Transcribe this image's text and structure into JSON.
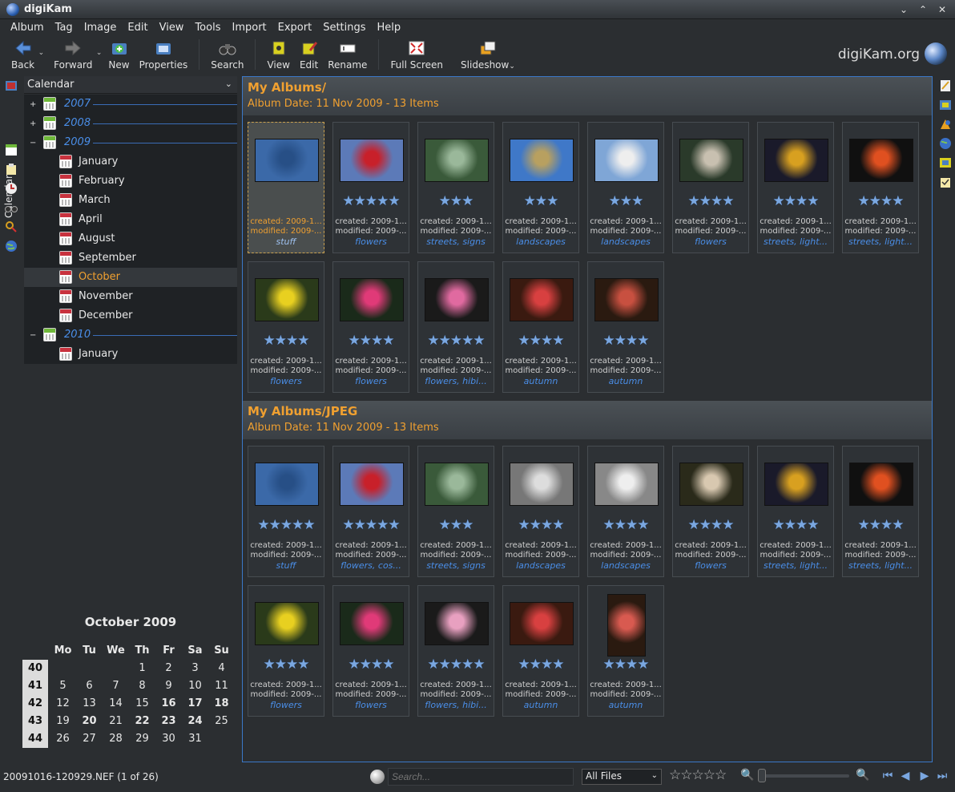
{
  "window": {
    "title": "digiKam",
    "controls": [
      "⌄",
      "⌃",
      "✕"
    ]
  },
  "menu": [
    "Album",
    "Tag",
    "Image",
    "Edit",
    "View",
    "Tools",
    "Import",
    "Export",
    "Settings",
    "Help"
  ],
  "toolbar": {
    "back": "Back",
    "forward": "Forward",
    "new": "New",
    "properties": "Properties",
    "search": "Search",
    "view": "View",
    "edit": "Edit",
    "rename": "Rename",
    "fullscreen": "Full Screen",
    "slideshow": "Slideshow",
    "brand": "digiKam.org"
  },
  "sidebar": {
    "tab": "Calendar",
    "combo": "Calendar",
    "tree": [
      {
        "label": "2007",
        "type": "year",
        "expander": "+"
      },
      {
        "label": "2008",
        "type": "year",
        "expander": "+"
      },
      {
        "label": "2009",
        "type": "year",
        "expander": "−"
      },
      {
        "label": "January",
        "type": "month"
      },
      {
        "label": "February",
        "type": "month"
      },
      {
        "label": "March",
        "type": "month"
      },
      {
        "label": "April",
        "type": "month"
      },
      {
        "label": "August",
        "type": "month"
      },
      {
        "label": "September",
        "type": "month"
      },
      {
        "label": "October",
        "type": "month",
        "selected": true
      },
      {
        "label": "November",
        "type": "month"
      },
      {
        "label": "December",
        "type": "month"
      },
      {
        "label": "2010",
        "type": "year",
        "expander": "−"
      },
      {
        "label": "January",
        "type": "month"
      }
    ]
  },
  "calendar": {
    "title": "October 2009",
    "headers": [
      "Mo",
      "Tu",
      "We",
      "Th",
      "Fr",
      "Sa",
      "Su"
    ],
    "weeks": [
      {
        "week": "40",
        "days": [
          "",
          "",
          "",
          "1",
          "2",
          "3",
          "4"
        ],
        "bold": []
      },
      {
        "week": "41",
        "days": [
          "5",
          "6",
          "7",
          "8",
          "9",
          "10",
          "11"
        ],
        "bold": []
      },
      {
        "week": "42",
        "days": [
          "12",
          "13",
          "14",
          "15",
          "16",
          "17",
          "18"
        ],
        "bold": [
          "16",
          "17",
          "18"
        ]
      },
      {
        "week": "43",
        "days": [
          "19",
          "20",
          "21",
          "22",
          "23",
          "24",
          "25"
        ],
        "bold": [
          "20",
          "22",
          "23",
          "24"
        ]
      },
      {
        "week": "44",
        "days": [
          "26",
          "27",
          "28",
          "29",
          "30",
          "31",
          ""
        ],
        "bold": []
      }
    ]
  },
  "albums": [
    {
      "title": "My Albums/",
      "subtitle": "Album Date: 11 Nov 2009 - 13 Items",
      "items": [
        {
          "stars": 0,
          "tags": "stuff",
          "selected": true,
          "photo": "heart-on-denim",
          "colors": [
            "#3b69a8",
            "#274f86"
          ]
        },
        {
          "stars": 5,
          "tags": "flowers",
          "photo": "red-flower",
          "colors": [
            "#5c7ab8",
            "#c8202a"
          ]
        },
        {
          "stars": 3,
          "tags": "streets, signs",
          "photo": "street-sign",
          "colors": [
            "#3a5a3a",
            "#9ab89a"
          ]
        },
        {
          "stars": 3,
          "tags": "landscapes",
          "photo": "landscape-sky",
          "colors": [
            "#3f78c8",
            "#b8a060"
          ]
        },
        {
          "stars": 3,
          "tags": "landscapes",
          "photo": "cloudy-sky",
          "colors": [
            "#7fa6d6",
            "#eeeeee"
          ]
        },
        {
          "stars": 4,
          "tags": "flowers",
          "photo": "white-blossom",
          "colors": [
            "#2a3a2a",
            "#c8c0b0"
          ]
        },
        {
          "stars": 4,
          "tags": "streets, light...",
          "photo": "night-lights",
          "colors": [
            "#1a1a2a",
            "#d8a020"
          ]
        },
        {
          "stars": 4,
          "tags": "streets, light...",
          "photo": "night-trees",
          "colors": [
            "#101010",
            "#e05020"
          ]
        },
        {
          "stars": 4,
          "tags": "flowers",
          "photo": "yellow-flower",
          "colors": [
            "#2a3a1a",
            "#e8d020"
          ]
        },
        {
          "stars": 4,
          "tags": "flowers",
          "photo": "pink-flower",
          "colors": [
            "#1a2a1a",
            "#e03a78"
          ]
        },
        {
          "stars": 5,
          "tags": "flowers, hibi...",
          "photo": "hibiscus",
          "colors": [
            "#1a1a1a",
            "#e06aa0"
          ]
        },
        {
          "stars": 4,
          "tags": "autumn",
          "photo": "autumn-leaf",
          "colors": [
            "#3a1a10",
            "#d84040"
          ]
        },
        {
          "stars": 4,
          "tags": "autumn",
          "photo": "autumn-leaf-2",
          "colors": [
            "#2a1a10",
            "#c85040"
          ]
        }
      ]
    },
    {
      "title": "My Albums/JPEG",
      "subtitle": "Album Date: 11 Nov 2009 - 13 Items",
      "items": [
        {
          "stars": 5,
          "tags": "stuff",
          "photo": "heart-on-denim",
          "colors": [
            "#3b69a8",
            "#274f86"
          ]
        },
        {
          "stars": 5,
          "tags": "flowers, cos...",
          "photo": "red-flower",
          "colors": [
            "#5c7ab8",
            "#c8202a"
          ]
        },
        {
          "stars": 3,
          "tags": "streets, signs",
          "photo": "street-sign",
          "colors": [
            "#3a5a3a",
            "#9ab89a"
          ]
        },
        {
          "stars": 4,
          "tags": "landscapes",
          "photo": "bw-landscape",
          "colors": [
            "#777777",
            "#dddddd"
          ]
        },
        {
          "stars": 4,
          "tags": "landscapes",
          "photo": "bw-sky",
          "colors": [
            "#888888",
            "#eeeeee"
          ]
        },
        {
          "stars": 4,
          "tags": "flowers",
          "photo": "white-blossom",
          "colors": [
            "#2a2a1a",
            "#d8c8b0"
          ]
        },
        {
          "stars": 4,
          "tags": "streets, light...",
          "photo": "night-lights",
          "colors": [
            "#1a1a2a",
            "#d8a020"
          ]
        },
        {
          "stars": 4,
          "tags": "streets, light...",
          "photo": "night-trees",
          "colors": [
            "#101010",
            "#e05020"
          ]
        },
        {
          "stars": 4,
          "tags": "flowers",
          "photo": "yellow-flower",
          "colors": [
            "#2a3a1a",
            "#e8d020"
          ]
        },
        {
          "stars": 4,
          "tags": "flowers",
          "photo": "pink-flower",
          "colors": [
            "#1a2a1a",
            "#e03a78"
          ]
        },
        {
          "stars": 5,
          "tags": "flowers, hibi...",
          "photo": "hibiscus",
          "colors": [
            "#1a1a1a",
            "#e8a0c0"
          ]
        },
        {
          "stars": 4,
          "tags": "autumn",
          "photo": "autumn-leaf",
          "colors": [
            "#3a1a10",
            "#d84040"
          ]
        },
        {
          "stars": 4,
          "tags": "autumn",
          "photo": "autumn-leaf-tall",
          "tall": true,
          "colors": [
            "#2a1a10",
            "#d85a50"
          ]
        }
      ]
    }
  ],
  "item_meta": {
    "created": "created: 2009-1...",
    "modified": "modified: 2009-..."
  },
  "status": {
    "file": "20091016-120929.NEF (1 of 26)",
    "search_placeholder": "Search...",
    "filter": "All Files"
  },
  "accent": "#f0a030",
  "link_color": "#4a8ee8"
}
